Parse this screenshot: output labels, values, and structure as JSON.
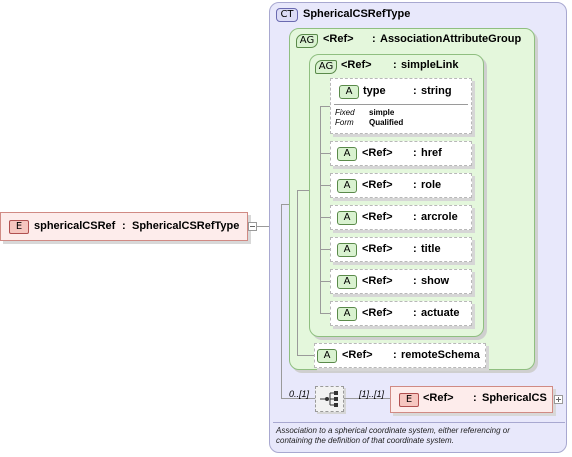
{
  "root_element": {
    "badge": "E",
    "name": "sphericalCSRef",
    "sep": ":",
    "type": "SphericalCSRefType"
  },
  "complex_type": {
    "badge": "CT",
    "name": "SphericalCSRefType"
  },
  "attribute_group": {
    "badge": "AG",
    "ref": "<Ref>",
    "sep": ":",
    "name": "AssociationAttributeGroup"
  },
  "simple_link": {
    "badge": "AG",
    "ref": "<Ref>",
    "sep": ":",
    "name": "simpleLink",
    "type_attr": {
      "badge": "A",
      "name": "type",
      "sep": ":",
      "type": "string",
      "fixed_label": "Fixed",
      "fixed_value": "simple",
      "form_label": "Form",
      "form_value": "Qualified"
    },
    "attributes": [
      {
        "badge": "A",
        "ref": "<Ref>",
        "sep": ":",
        "name": "href"
      },
      {
        "badge": "A",
        "ref": "<Ref>",
        "sep": ":",
        "name": "role"
      },
      {
        "badge": "A",
        "ref": "<Ref>",
        "sep": ":",
        "name": "arcrole"
      },
      {
        "badge": "A",
        "ref": "<Ref>",
        "sep": ":",
        "name": "title"
      },
      {
        "badge": "A",
        "ref": "<Ref>",
        "sep": ":",
        "name": "show"
      },
      {
        "badge": "A",
        "ref": "<Ref>",
        "sep": ":",
        "name": "actuate"
      }
    ]
  },
  "remote_schema": {
    "badge": "A",
    "ref": "<Ref>",
    "sep": ":",
    "name": "remoteSchema"
  },
  "sequence": {
    "cardinality": "0..[1]",
    "child_cardinality": "[1]..[1]"
  },
  "child_element": {
    "badge": "E",
    "ref": "<Ref>",
    "sep": ":",
    "name": "SphericalCS"
  },
  "annotation": {
    "line1": "Association to a spherical coordinate system, either referencing or",
    "line2": "containing the definition of that coordinate system."
  },
  "colors": {
    "complex_type_bg": "#e8e8fb",
    "group_bg": "#e4f7dc",
    "element_bg": "#fdeceb",
    "attr_badge": "#d9f2d0",
    "element_badge": "#f6c6c0",
    "ct_badge": "#dcdcf6"
  }
}
